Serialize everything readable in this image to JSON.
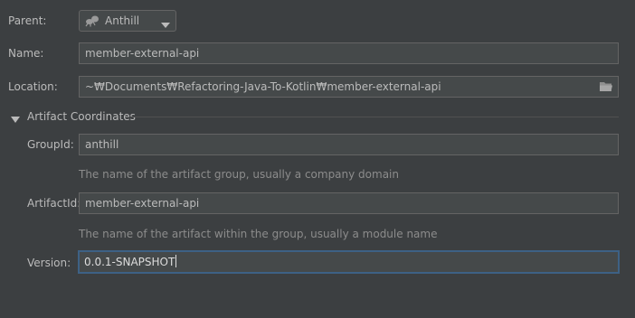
{
  "parent": {
    "label": "Parent:",
    "value": "Anthill",
    "icon": "ant-icon"
  },
  "name": {
    "label": "Name:",
    "value": "member-external-api"
  },
  "location": {
    "label": "Location:",
    "value": "~₩Documents₩Refactoring-Java-To-Kotlin₩member-external-api",
    "browse_icon": "folder-icon"
  },
  "artifact_coordinates": {
    "title": "Artifact Coordinates",
    "expanded": true,
    "group_id": {
      "label": "GroupId:",
      "value": "anthill",
      "hint": "The name of the artifact group, usually a company domain"
    },
    "artifact_id": {
      "label": "ArtifactId:",
      "value": "member-external-api",
      "hint": "The name of the artifact within the group, usually a module name"
    },
    "version": {
      "label": "Version:",
      "value": "0.0.1-SNAPSHOT"
    }
  },
  "colors": {
    "background": "#3c3f41",
    "field_background": "#45494a",
    "field_border": "#646464",
    "focus_border": "#3d6185",
    "text": "#bbbbbb",
    "hint_text": "#8c8c8c"
  }
}
